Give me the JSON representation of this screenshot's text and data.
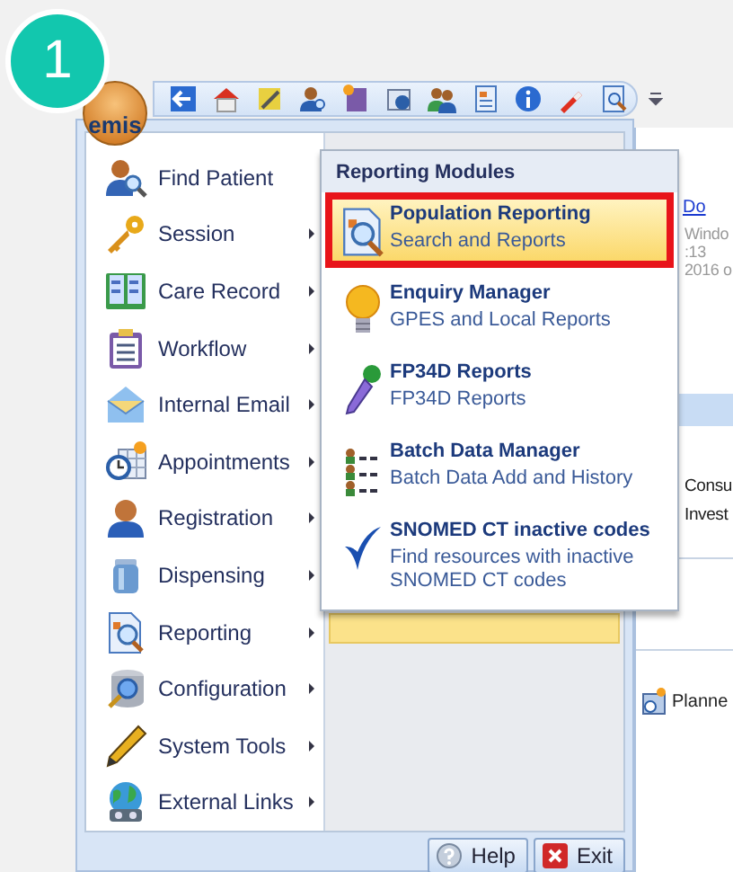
{
  "badge": "1",
  "logo": "emis",
  "menu": {
    "items": [
      {
        "label": "Find Patient",
        "has_submenu": false
      },
      {
        "label": "Session",
        "has_submenu": true
      },
      {
        "label": "Care Record",
        "has_submenu": true
      },
      {
        "label": "Workflow",
        "has_submenu": true
      },
      {
        "label": "Internal Email",
        "has_submenu": true
      },
      {
        "label": "Appointments",
        "has_submenu": true
      },
      {
        "label": "Registration",
        "has_submenu": true
      },
      {
        "label": "Dispensing",
        "has_submenu": true
      },
      {
        "label": "Reporting",
        "has_submenu": true
      },
      {
        "label": "Configuration",
        "has_submenu": true
      },
      {
        "label": "System Tools",
        "has_submenu": true
      },
      {
        "label": "External Links",
        "has_submenu": true
      }
    ]
  },
  "submenu": {
    "title": "Reporting Modules",
    "items": [
      {
        "title": "Population Reporting",
        "subtitle": "Search and Reports",
        "highlighted": true
      },
      {
        "title": "Enquiry Manager",
        "subtitle": "GPES and Local Reports",
        "highlighted": false
      },
      {
        "title": "FP34D Reports",
        "subtitle": "FP34D Reports",
        "highlighted": false
      },
      {
        "title": "Batch Data Manager",
        "subtitle": "Batch Data Add and History",
        "highlighted": false
      },
      {
        "title": "SNOMED CT inactive codes",
        "subtitle": "Find resources with inactive SNOMED CT codes",
        "highlighted": false
      }
    ]
  },
  "buttons": [
    {
      "label": "Help",
      "kind": "help"
    },
    {
      "label": "Exit",
      "kind": "exit"
    }
  ],
  "background_pane": {
    "link": "Do",
    "lines": [
      "Windo",
      ":13",
      "2016 o"
    ],
    "rows": [
      "Consu",
      "Invest"
    ],
    "planned": "Planne"
  }
}
